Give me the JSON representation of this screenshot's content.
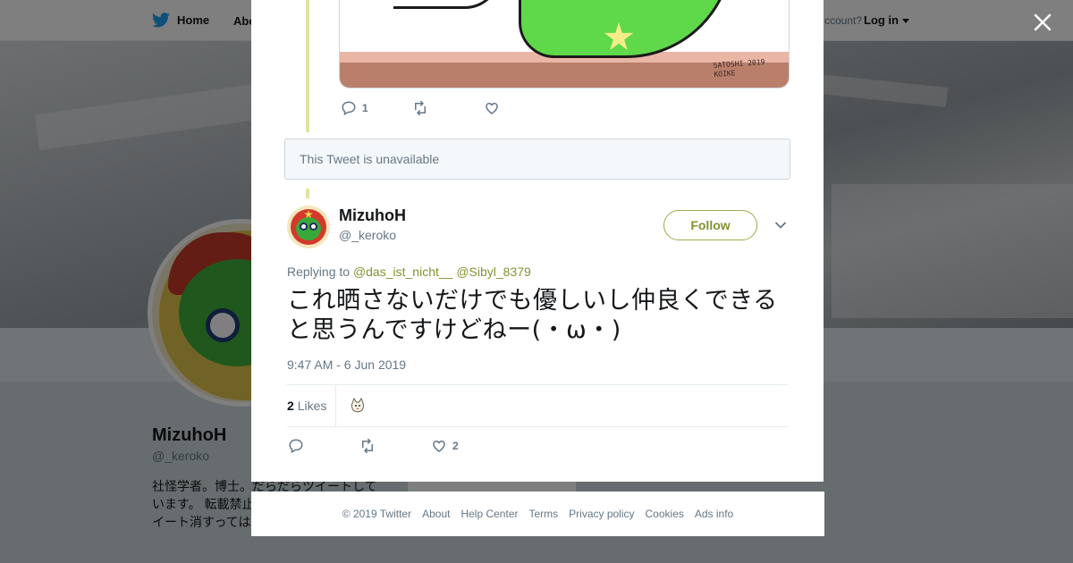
{
  "background_page": {
    "nav": {
      "home": "Home",
      "about": "Abo",
      "account_prompt": "ccount?",
      "login": "Log in"
    },
    "profile": {
      "name": "MizuhoH",
      "handle": "@_keroko",
      "bio": "社怪学者。博士。だらだらツイートして います。 転載禁止 たち」(青弓社)ア らツイート消すっては。"
    }
  },
  "modal": {
    "previous_tweet": {
      "media_signature": "SATOSHI 2019 KOIKE",
      "reply_count": "1"
    },
    "unavailable_notice": "This Tweet is unavailable",
    "tweet": {
      "author_name": "MizuhoH",
      "author_handle": "@_keroko",
      "follow_label": "Follow",
      "replying_prefix": "Replying to",
      "replying_to": [
        "@das_ist_nicht__",
        "@Sibyl_8379"
      ],
      "text": "これ晒さないだけでも優しいし仲良くできると思うんですけどねー(・ω・)",
      "timestamp": "9:47 AM - 6 Jun 2019",
      "likes_count": "2",
      "likes_label": "Likes",
      "like_action_count": "2"
    }
  },
  "footer": {
    "links": [
      "© 2019 Twitter",
      "About",
      "Help Center",
      "Terms",
      "Privacy policy",
      "Cookies",
      "Ads info"
    ]
  },
  "icons": {
    "close": "close-icon",
    "reply": "reply-icon",
    "retweet": "retweet-icon",
    "like": "heart-icon",
    "caret": "chevron-down-icon",
    "brand": "twitter-bird-icon"
  },
  "colors": {
    "accent": "#7f9430",
    "text_secondary": "#657786",
    "thread_line": "#e0e3a3"
  }
}
